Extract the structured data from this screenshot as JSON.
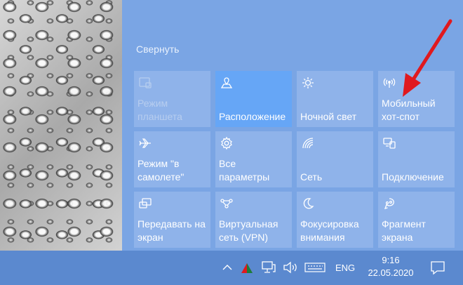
{
  "action_center": {
    "collapse_label": "Свернуть",
    "tiles": [
      {
        "label": "Режим\nпланшета",
        "icon": "tablet-mode-icon",
        "state": "disabled"
      },
      {
        "label": "Расположение",
        "icon": "location-icon",
        "state": "active"
      },
      {
        "label": "Ночной свет",
        "icon": "night-light-icon",
        "state": "normal"
      },
      {
        "label": "Мобильный\nхот-спот",
        "icon": "mobile-hotspot-icon",
        "state": "normal"
      },
      {
        "label": "Режим \"в\nсамолете\"",
        "icon": "airplane-mode-icon",
        "state": "normal"
      },
      {
        "label": "Все параметры",
        "icon": "settings-gear-icon",
        "state": "normal"
      },
      {
        "label": "Сеть",
        "icon": "network-icon",
        "state": "normal"
      },
      {
        "label": "Подключение",
        "icon": "connect-icon",
        "state": "normal"
      },
      {
        "label": "Передавать на\nэкран",
        "icon": "project-icon",
        "state": "normal"
      },
      {
        "label": "Виртуальная\nсеть (VPN)",
        "icon": "vpn-icon",
        "state": "normal"
      },
      {
        "label": "Фокусировка\nвнимания",
        "icon": "focus-assist-icon",
        "state": "normal"
      },
      {
        "label": "Фрагмент\nэкрана",
        "icon": "screen-snip-icon",
        "state": "normal"
      }
    ]
  },
  "taskbar": {
    "language": "ENG",
    "time": "9:16",
    "date": "22.05.2020"
  },
  "colors": {
    "panel": "#7aa5e4",
    "tile": "#8fb3ea",
    "tile_active": "#66a6f6",
    "taskbar": "#5b89cf",
    "annotation_arrow": "#e0191e"
  }
}
